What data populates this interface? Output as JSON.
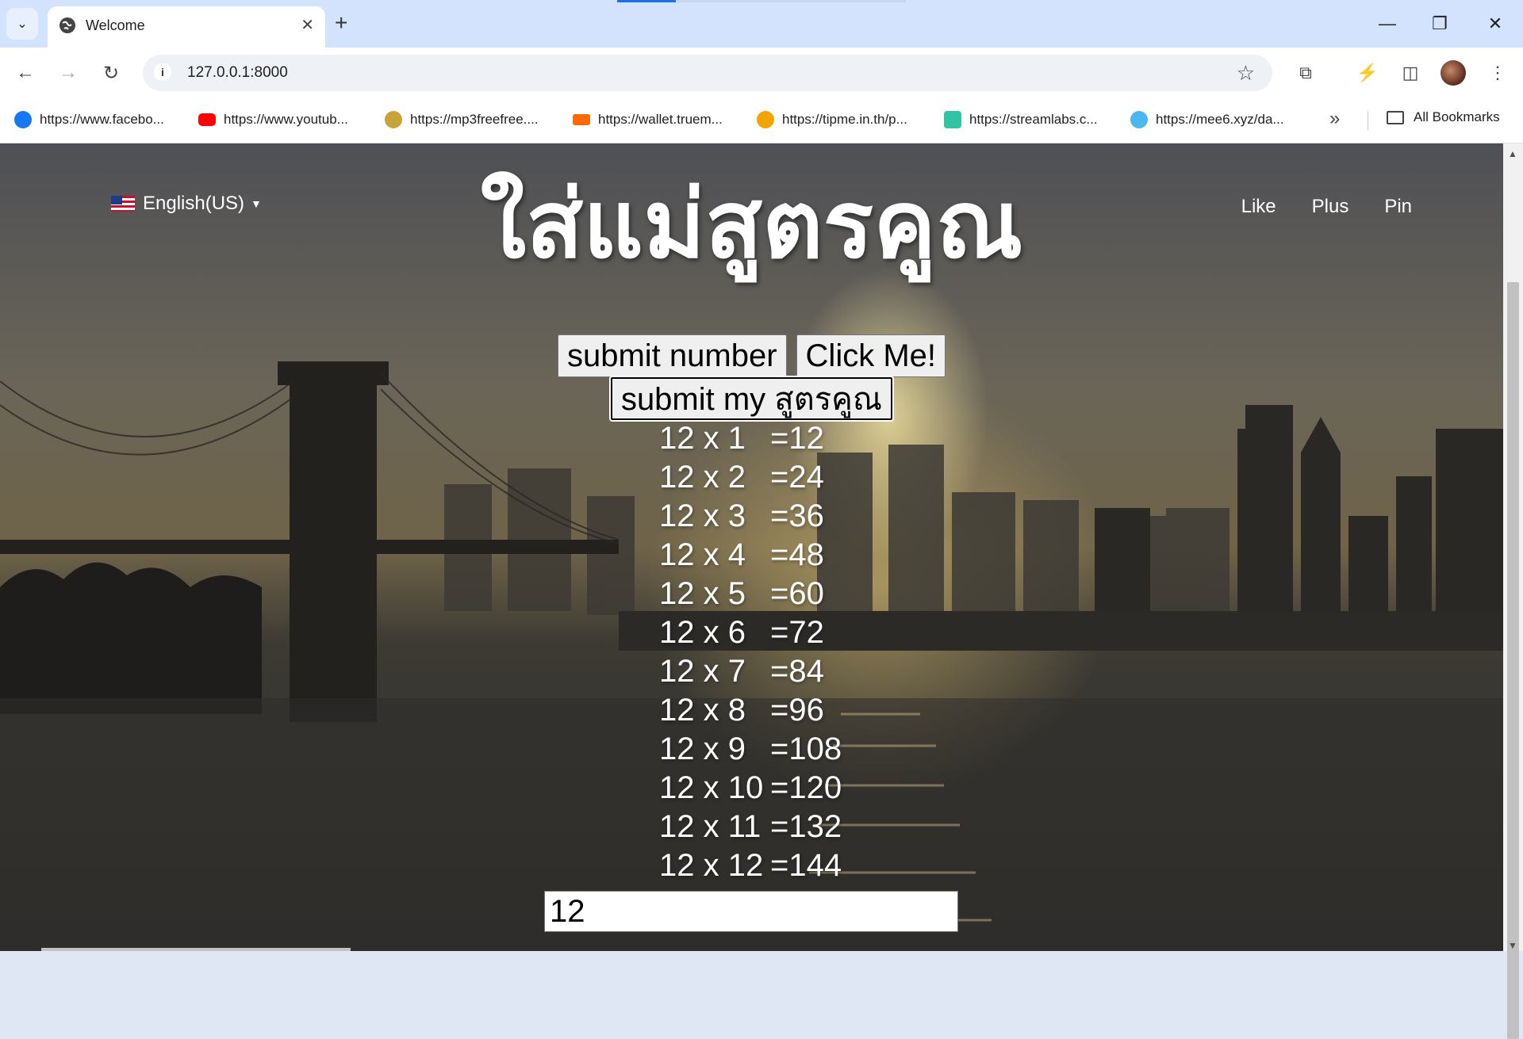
{
  "browser": {
    "tab": {
      "title": "Welcome"
    },
    "address": {
      "url": "127.0.0.1:8000"
    },
    "bookmarks": [
      {
        "label": "https://www.facebo...",
        "icon": "facebook-icon",
        "color": "#1877f2"
      },
      {
        "label": "https://www.youtub...",
        "icon": "youtube-icon",
        "color": "#ff0000"
      },
      {
        "label": "https://mp3freefree....",
        "icon": "mp3freefree-icon",
        "color": "#c9a23a"
      },
      {
        "label": "https://wallet.truem...",
        "icon": "truemoney-icon",
        "color": "#ff6a00"
      },
      {
        "label": "https://tipme.in.th/p...",
        "icon": "tipme-icon",
        "color": "#f4a300"
      },
      {
        "label": "https://streamlabs.c...",
        "icon": "streamlabs-icon",
        "color": "#31c3a2"
      },
      {
        "label": "https://mee6.xyz/da...",
        "icon": "mee6-icon",
        "color": "#4ab7f0"
      }
    ],
    "all_bookmarks_label": "All Bookmarks"
  },
  "page": {
    "language": "English(US)",
    "heading": "ใส่แม่สูตรคูณ",
    "nav": [
      "Like",
      "Plus",
      "Pin"
    ],
    "buttons": {
      "submit_number": "submit number",
      "click_me": "Click Me!",
      "submit_formula": "submit my สูตรคูณ"
    },
    "table": [
      {
        "lhs": "12 x 1",
        "rhs": "=12"
      },
      {
        "lhs": "12 x 2",
        "rhs": "=24"
      },
      {
        "lhs": "12 x 3",
        "rhs": "=36"
      },
      {
        "lhs": "12 x 4",
        "rhs": "=48"
      },
      {
        "lhs": "12 x 5",
        "rhs": "=60"
      },
      {
        "lhs": "12 x 6",
        "rhs": "=72"
      },
      {
        "lhs": "12 x 7",
        "rhs": "=84"
      },
      {
        "lhs": "12 x 8",
        "rhs": "=96"
      },
      {
        "lhs": "12 x 9",
        "rhs": "=108"
      },
      {
        "lhs": "12 x 10",
        "rhs": "=120"
      },
      {
        "lhs": "12 x 11",
        "rhs": "=132"
      },
      {
        "lhs": "12 x 12",
        "rhs": "=144"
      }
    ],
    "input_value": "12"
  }
}
